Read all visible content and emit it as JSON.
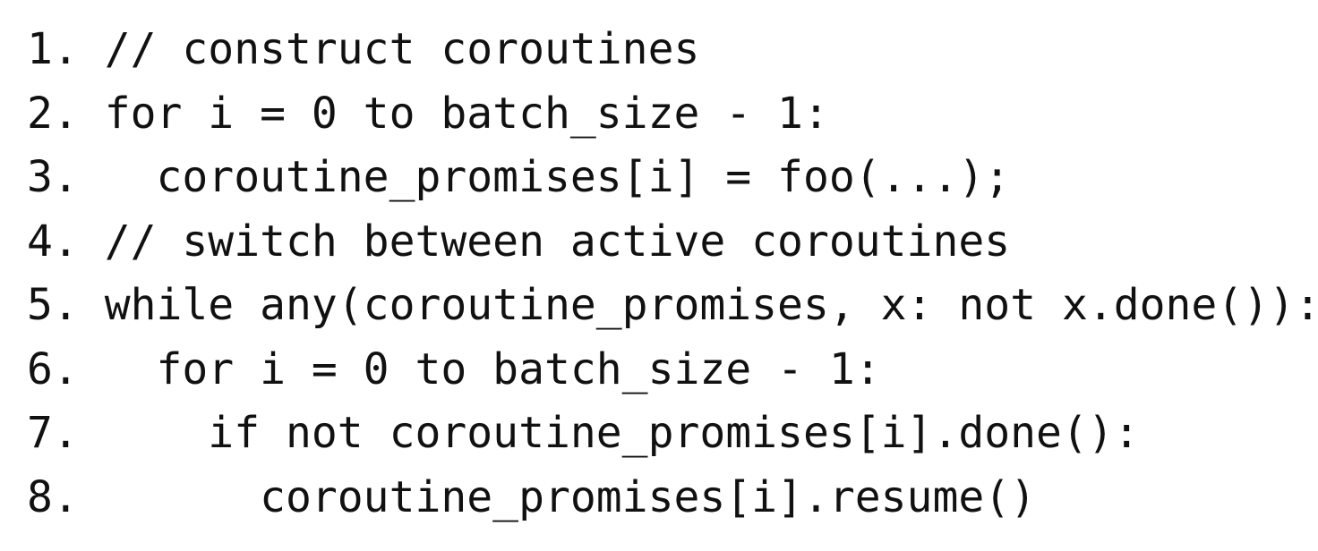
{
  "code": {
    "lines": [
      "1. // construct coroutines",
      "2. for i = 0 to batch_size - 1:",
      "3.   coroutine_promises[i] = foo(...);",
      "4. // switch between active coroutines",
      "5. while any(coroutine_promises, x: not x.done()):",
      "6.   for i = 0 to batch_size - 1:",
      "7.     if not coroutine_promises[i].done():",
      "8.       coroutine_promises[i].resume()"
    ]
  }
}
